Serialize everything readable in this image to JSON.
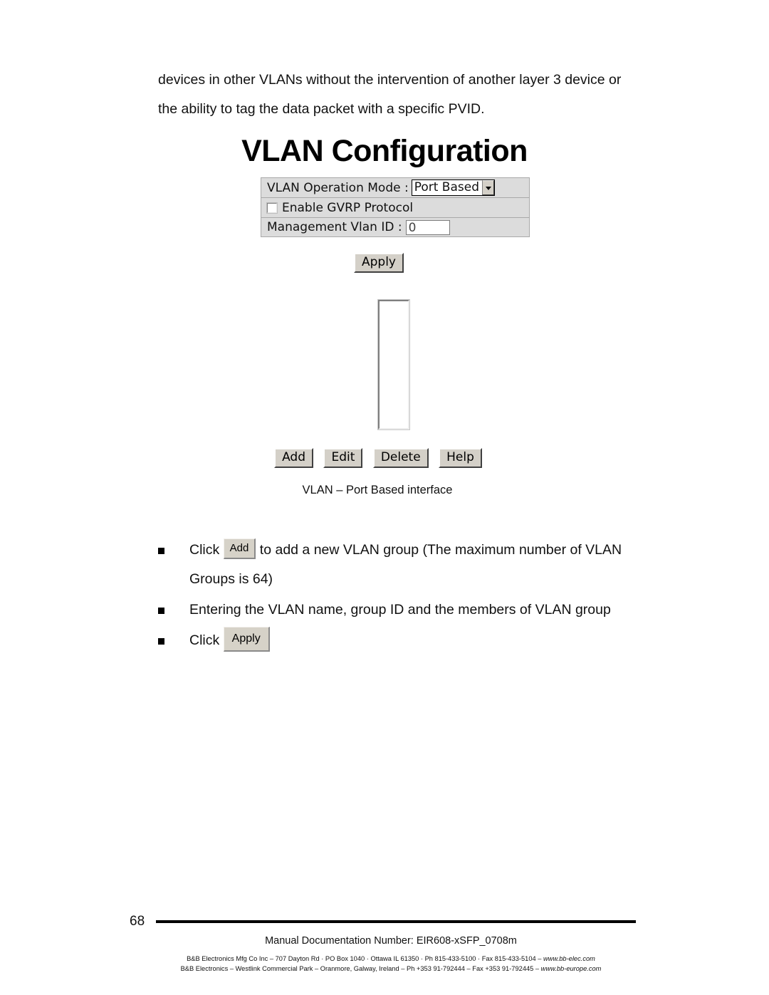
{
  "document": {
    "intro_paragraph": "devices in other VLANs without the intervention of another layer 3 device or the ability to tag the data packet with a specific PVID.",
    "page_number": "68"
  },
  "figure": {
    "title": "VLAN Configuration",
    "caption": "VLAN – Port Based interface",
    "form": {
      "operation_mode_label": "VLAN Operation Mode :",
      "operation_mode_value": "Port Based",
      "operation_mode_options": [
        "Port Based"
      ],
      "gvrp_label": "Enable GVRP Protocol",
      "gvrp_checked": false,
      "mgmt_vlan_label": "Management Vlan ID :",
      "mgmt_vlan_value": "0"
    },
    "apply_label": "Apply",
    "list_items": [],
    "buttons": {
      "add": "Add",
      "edit": "Edit",
      "delete": "Delete",
      "help": "Help"
    }
  },
  "bullets": [
    {
      "text_before": "Click",
      "button_label": "Add",
      "text_after": "to add a new VLAN group (The maximum number of VLAN Groups is 64)"
    },
    {
      "text_before": "Entering the VLAN name, group ID and the members of VLAN group",
      "button_label": "",
      "text_after": ""
    },
    {
      "text_before": "Click",
      "button_label": "Apply",
      "text_after": ""
    }
  ],
  "footer": {
    "doc_number_line": "Manual Documentation Number: EIR608-xSFP_0708m",
    "address_line_1_plain": "B&B Electronics Mfg Co Inc – 707 Dayton Rd · PO Box 1040 · Ottawa IL 61350 · Ph 815-433-5100 · Fax 815-433-5104 – ",
    "address_line_1_url": "www.bb-elec.com",
    "address_line_2_plain": "B&B Electronics – Westlink Commercial Park – Oranmore, Galway, Ireland – Ph +353 91-792444 – Fax +353 91-792445 – ",
    "address_line_2_url": "www.bb-europe.com"
  },
  "colors": {
    "panel_bg": "#dcdcdc",
    "panel_border": "#a9a9a9",
    "button_face": "#d4d0c8",
    "text": "#111111"
  }
}
